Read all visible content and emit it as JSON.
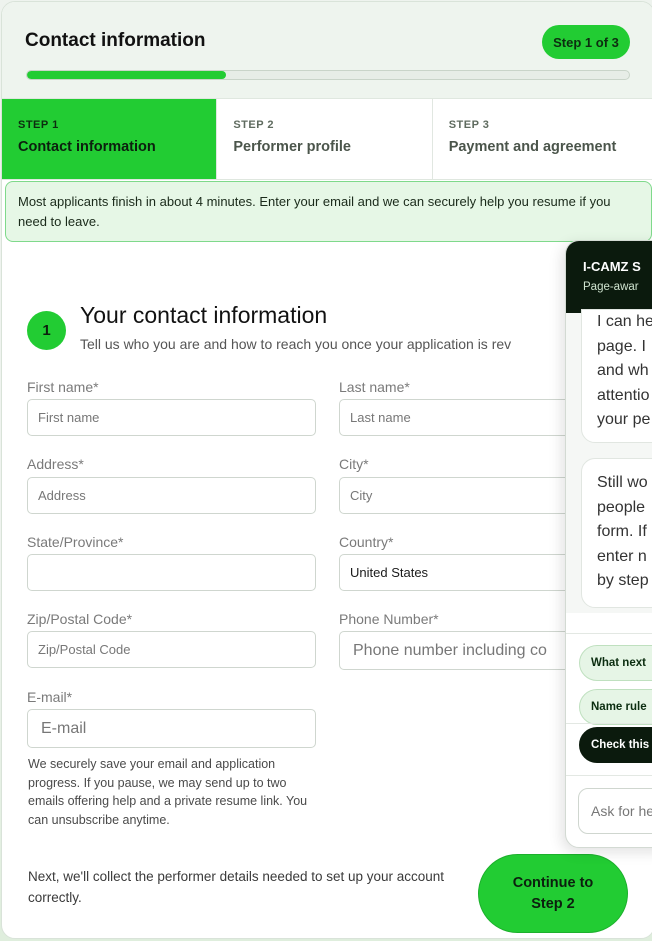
{
  "header": {
    "title": "Contact information",
    "step_badge": "Step 1 of 3",
    "progress": 0.33
  },
  "steps": [
    {
      "num": "STEP 1",
      "name": "Contact information",
      "active": true
    },
    {
      "num": "STEP 2",
      "name": "Performer profile",
      "active": false
    },
    {
      "num": "STEP 3",
      "name": "Payment and agreement",
      "active": false
    }
  ],
  "notice": "Most applicants finish in about 4 minutes. Enter your email and we can securely help you resume if you need to leave.",
  "section": {
    "number": "1",
    "title": "Your contact information",
    "subtitle": "Tell us who you are and how to reach you once your application is rev"
  },
  "fields": {
    "first_name": {
      "label": "First name*",
      "placeholder": "First name",
      "value": ""
    },
    "last_name": {
      "label": "Last name*",
      "placeholder": "Last name",
      "value": ""
    },
    "address": {
      "label": "Address*",
      "placeholder": "Address",
      "value": ""
    },
    "city": {
      "label": "City*",
      "placeholder": "City",
      "value": ""
    },
    "state": {
      "label": "State/Province*",
      "placeholder": "",
      "value": ""
    },
    "country": {
      "label": "Country*",
      "value": "United States"
    },
    "zip": {
      "label": "Zip/Postal Code*",
      "placeholder": "Zip/Postal Code",
      "value": ""
    },
    "phone": {
      "label": "Phone Number*",
      "placeholder": "Phone number including co",
      "value": ""
    },
    "email": {
      "label": "E-mail*",
      "placeholder": "E-mail",
      "value": ""
    }
  },
  "email_help": "We securely save your email and application progress. If you pause, we may send up to two emails offering help and a private resume link. You can unsubscribe anytime.",
  "next_note": "Next, we'll collect the performer details needed to set up your account correctly.",
  "continue_label": "Continue to Step 2",
  "chat": {
    "title": "I-CAMZ S",
    "subtitle": "Page-awar",
    "messages": [
      [
        "I can he",
        "page. I",
        "and wh",
        "attentio",
        "your pe"
      ],
      [
        "Still wo",
        "people",
        "form. If",
        "enter n",
        "by step"
      ]
    ],
    "chips": [
      "What next",
      "Name rule",
      "Check this"
    ],
    "input_placeholder": "Ask for he"
  }
}
